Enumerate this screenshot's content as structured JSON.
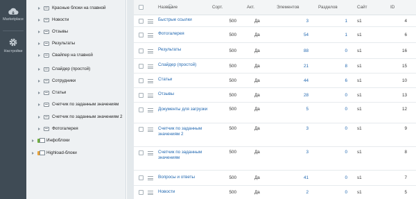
{
  "rail": {
    "items": [
      {
        "label": "Marketplace",
        "icon": "cloud-icon"
      },
      {
        "label": "Настройки",
        "icon": "gear-icon"
      }
    ]
  },
  "tree": {
    "items": [
      {
        "label": "Красные блоки на главной",
        "kind": "folder"
      },
      {
        "label": "Новости",
        "kind": "folder"
      },
      {
        "label": "Отзывы",
        "kind": "folder"
      },
      {
        "label": "Результаты",
        "kind": "folder"
      },
      {
        "label": "Свайпер на главной",
        "kind": "folder"
      },
      {
        "label": "Слайдер (простой)",
        "kind": "folder"
      },
      {
        "label": "Сотрудники",
        "kind": "folder"
      },
      {
        "label": "Статьи",
        "kind": "folder"
      },
      {
        "label": "Счетчик по заданным значениям",
        "kind": "folder"
      },
      {
        "label": "Счетчик по заданным значениям 2",
        "kind": "folder"
      },
      {
        "label": "Фотогалерея",
        "kind": "folder"
      },
      {
        "label": "Инфоблоки",
        "kind": "iblock"
      },
      {
        "label": "Highload-блоки",
        "kind": "highload"
      }
    ]
  },
  "table": {
    "headers": {
      "name": "Название",
      "sort": "Сорт.",
      "active": "Акт.",
      "elements": "Элементов",
      "sections": "Разделов",
      "site": "Сайт",
      "id": "ID"
    },
    "rows": [
      {
        "name": "Быстрые ссылки",
        "sort": "500",
        "active": "Да",
        "elements": "3",
        "sections": "1",
        "site": "s1",
        "id": "4"
      },
      {
        "name": "Фотогалерея",
        "sort": "500",
        "active": "Да",
        "elements": "54",
        "sections": "1",
        "site": "s1",
        "id": "6"
      },
      {
        "name": "Результаты",
        "sort": "500",
        "active": "Да",
        "elements": "88",
        "sections": "0",
        "site": "s1",
        "id": "16"
      },
      {
        "name": "Слайдер (простой)",
        "sort": "500",
        "active": "Да",
        "elements": "21",
        "sections": "8",
        "site": "s1",
        "id": "15"
      },
      {
        "name": "Статьи",
        "sort": "500",
        "active": "Да",
        "elements": "44",
        "sections": "6",
        "site": "s1",
        "id": "10"
      },
      {
        "name": "Отзывы",
        "sort": "500",
        "active": "Да",
        "elements": "28",
        "sections": "0",
        "site": "s1",
        "id": "13"
      },
      {
        "name": "Документы для загрузки",
        "sort": "500",
        "active": "Да",
        "elements": "5",
        "sections": "0",
        "site": "s1",
        "id": "12"
      },
      {
        "name": "Счетчик по заданным значениям 2",
        "sort": "500",
        "active": "Да",
        "elements": "3",
        "sections": "0",
        "site": "s1",
        "id": "9"
      },
      {
        "name": "Счетчик по заданным значениям",
        "sort": "500",
        "active": "Да",
        "elements": "3",
        "sections": "0",
        "site": "s1",
        "id": "8"
      },
      {
        "name": "Вопросы и ответы",
        "sort": "500",
        "active": "Да",
        "elements": "41",
        "sections": "0",
        "site": "s1",
        "id": "7"
      },
      {
        "name": "Новости",
        "sort": "500",
        "active": "Да",
        "elements": "2",
        "sections": "0",
        "site": "s1",
        "id": "5"
      }
    ]
  },
  "colors": {
    "rail": "#3f4b55",
    "tree_bg": "#eef1f3",
    "link": "#2067b0",
    "header_bg": "#f3f5f6"
  }
}
